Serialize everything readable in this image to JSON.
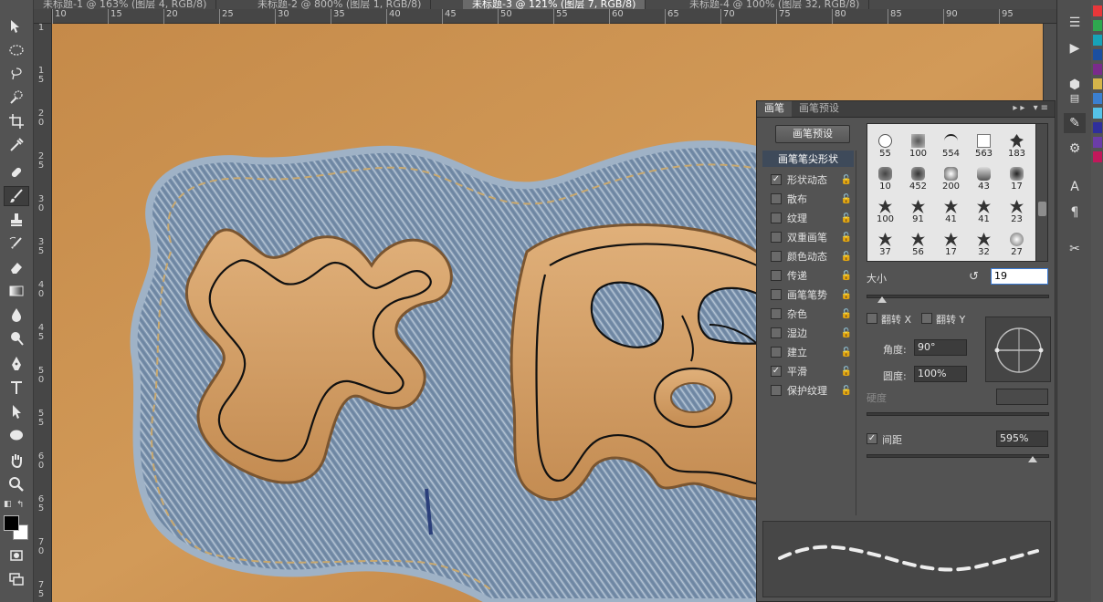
{
  "tabs": [
    {
      "label": "未标题-1 @ 163% (图层 4, RGB/8)",
      "active": false
    },
    {
      "label": "未标题-2 @ 800% (图层 1, RGB/8)",
      "active": false
    },
    {
      "label": "未标题-3 @ 121% (图层 7, RGB/8)",
      "active": true
    },
    {
      "label": "未标题-4 @ 100% (图层 32, RGB/8)",
      "active": false
    }
  ],
  "ruler_top": [
    "10",
    "15",
    "20",
    "25",
    "30",
    "35",
    "40",
    "45",
    "50",
    "55",
    "60",
    "65",
    "70",
    "75",
    "80",
    "85",
    "90",
    "95"
  ],
  "ruler_left": [
    "1",
    "1 5",
    "2 0",
    "2 5",
    "3 0",
    "3 5",
    "4 0",
    "4 5",
    "5 0",
    "5 5",
    "6 0",
    "6 5",
    "7 0",
    "7 5"
  ],
  "tools": [
    "move-icon",
    "marquee-icon",
    "lasso-icon",
    "quick-select-icon",
    "crop-icon",
    "eyedropper-icon",
    "healing-icon",
    "brush-icon",
    "stamp-icon",
    "history-brush-icon",
    "eraser-icon",
    "gradient-icon",
    "blur-icon",
    "dodge-icon",
    "pen-icon",
    "type-icon",
    "path-select-icon",
    "ellipse-icon",
    "hand-icon",
    "zoom-icon"
  ],
  "brush_panel": {
    "tab_brush": "画笔",
    "tab_presets": "画笔预设",
    "preset_button": "画笔预设",
    "options_header": "画笔笔尖形状",
    "options": [
      {
        "label": "形状动态",
        "checked": true
      },
      {
        "label": "散布",
        "checked": false
      },
      {
        "label": "纹理",
        "checked": false
      },
      {
        "label": "双重画笔",
        "checked": false
      },
      {
        "label": "颜色动态",
        "checked": false
      },
      {
        "label": "传递",
        "checked": false
      },
      {
        "label": "画笔笔势",
        "checked": false
      },
      {
        "label": "杂色",
        "checked": false
      },
      {
        "label": "湿边",
        "checked": false
      },
      {
        "label": "建立",
        "checked": false
      },
      {
        "label": "平滑",
        "checked": true
      },
      {
        "label": "保护纹理",
        "checked": false
      }
    ],
    "tips": [
      "55",
      "100",
      "554",
      "563",
      "183",
      "10",
      "452",
      "200",
      "43",
      "17",
      "100",
      "91",
      "41",
      "41",
      "23",
      "37",
      "56",
      "17",
      "32",
      "27"
    ],
    "size_label": "大小",
    "size_value": "19",
    "flip_x": "翻转 X",
    "flip_y": "翻转 Y",
    "angle_label": "角度:",
    "angle_value": "90°",
    "roundness_label": "圆度:",
    "roundness_value": "100%",
    "hardness_label": "硬度",
    "spacing_label": "间距",
    "spacing_checked": true,
    "spacing_value": "595%"
  },
  "dock_icons": [
    "history-icon",
    "play-icon",
    "3d-icon",
    "layers-icon",
    "brush-panel-icon",
    "adjust-icon",
    "character-icon",
    "paragraph-icon",
    "tools-preset-icon"
  ],
  "swatches": [
    "#e8373a",
    "#2fa84f",
    "#17a2b8",
    "#1b4fa0",
    "#7a2b8c",
    "#d4b44a",
    "#3b7fd0",
    "#55c2e8",
    "#2f2f9c",
    "#6b3da8",
    "#c2185b"
  ]
}
